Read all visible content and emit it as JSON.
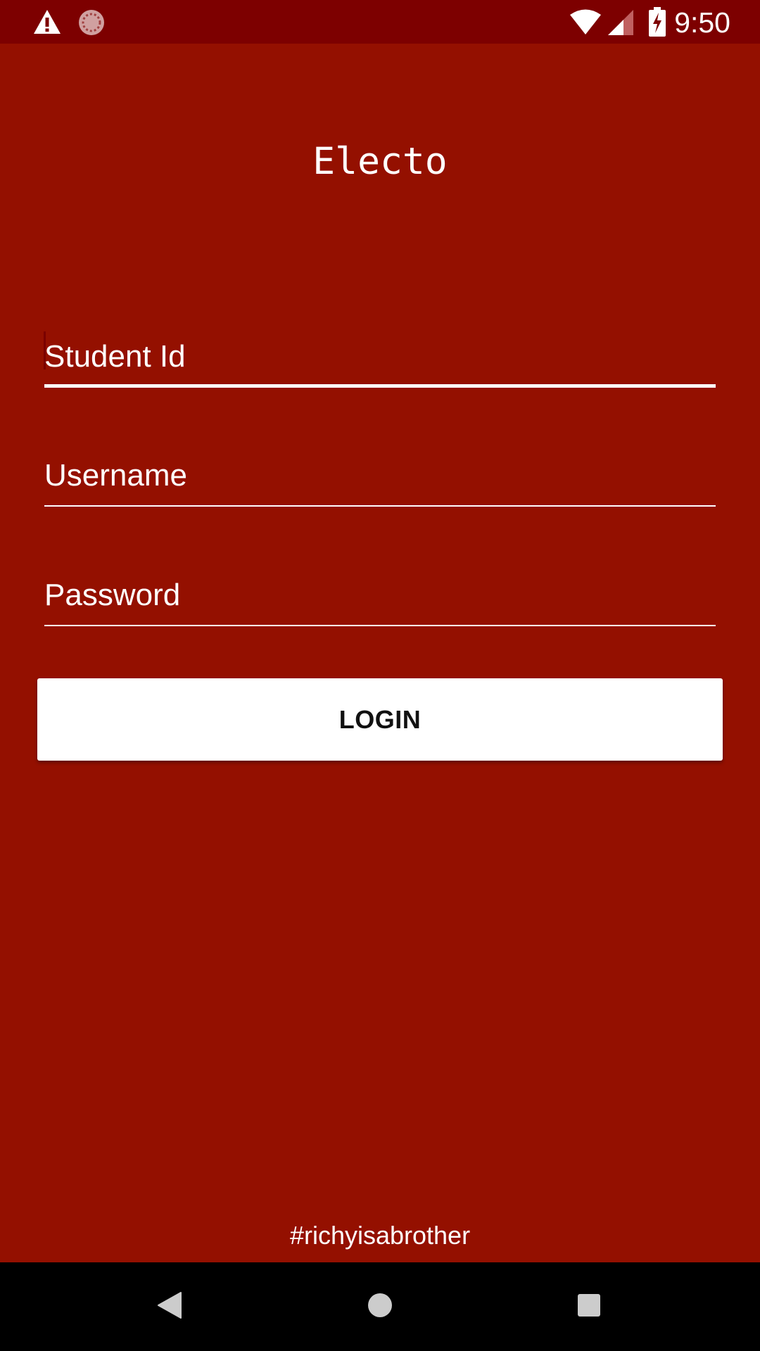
{
  "status_bar": {
    "time": "9:50",
    "left_icons": [
      "warning-icon",
      "sync-icon"
    ],
    "right_icons": [
      "wifi-icon",
      "cellular-signal-icon",
      "battery-charging-icon"
    ]
  },
  "app": {
    "title": "Electo"
  },
  "form": {
    "student_id_placeholder": "Student Id",
    "username_placeholder": "Username",
    "password_placeholder": "Password",
    "login_label": "LOGIN"
  },
  "footer": {
    "tagline": "#richyisabrother"
  },
  "nav_bar": {
    "buttons": [
      "back-icon",
      "home-icon",
      "recents-icon"
    ]
  },
  "colors": {
    "background": "#941000",
    "status_bar": "#7d0000",
    "accent": "#ffffff",
    "nav_bar": "#000000"
  }
}
